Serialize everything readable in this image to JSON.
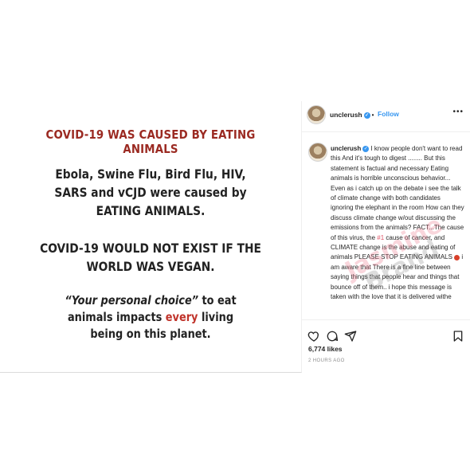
{
  "image": {
    "headline": "COVID-19 WAS CAUSED BY EATING ANIMALS",
    "block1": [
      "Ebola, Swine Flu, Bird Flu, HIV,",
      "SARS and vCJD were caused by",
      "EATING ANIMALS."
    ],
    "block2": [
      "COVID-19 WOULD NOT EXIST IF THE",
      "WORLD WAS VEGAN."
    ],
    "block3": {
      "quote": "“Your personal choice”",
      "line1_rest": " to eat",
      "line2_pre": "animals impacts ",
      "line2_emph": "every",
      "line2_post": " living",
      "line3": "being on this planet."
    },
    "colors": {
      "headline": "#9b2a22",
      "emphasis": "#c0332a"
    }
  },
  "header": {
    "username": "unclerush",
    "dot": "•",
    "follow_label": "Follow",
    "more": "•••"
  },
  "caption": {
    "username": "unclerush",
    "text_1": " I know people don't want to read this And it's tough to digest ........ But this statement is factual and necessary Eating animals is horrible unconscious behavior... Even as i catch up on the debate i see the talk of climate change with both candidates ignoring the elephant in the room How can they discuss climate change w/out discussing the emissions from the animals? FACT...The cause of this virus, the ",
    "highlight": "#1",
    "text_2": " cause of cancer, and CLIMATE change is the abuse and eating of animals PLEASE STOP EATING ANIMALS ",
    "text_3": " i am aware that There is a fine line between saying things that people hear and things that bounce off of them.. i hope this message is taken with the love that it is delivered withe"
  },
  "watermark": {
    "line1": "Jasmine",
    "line2": "Brand"
  },
  "likes": "6,774 likes",
  "timestamp": "2 HOURS AGO",
  "icons": [
    "heart-icon",
    "comment-icon",
    "share-icon",
    "bookmark-icon"
  ],
  "accent_color": "#3897f0"
}
